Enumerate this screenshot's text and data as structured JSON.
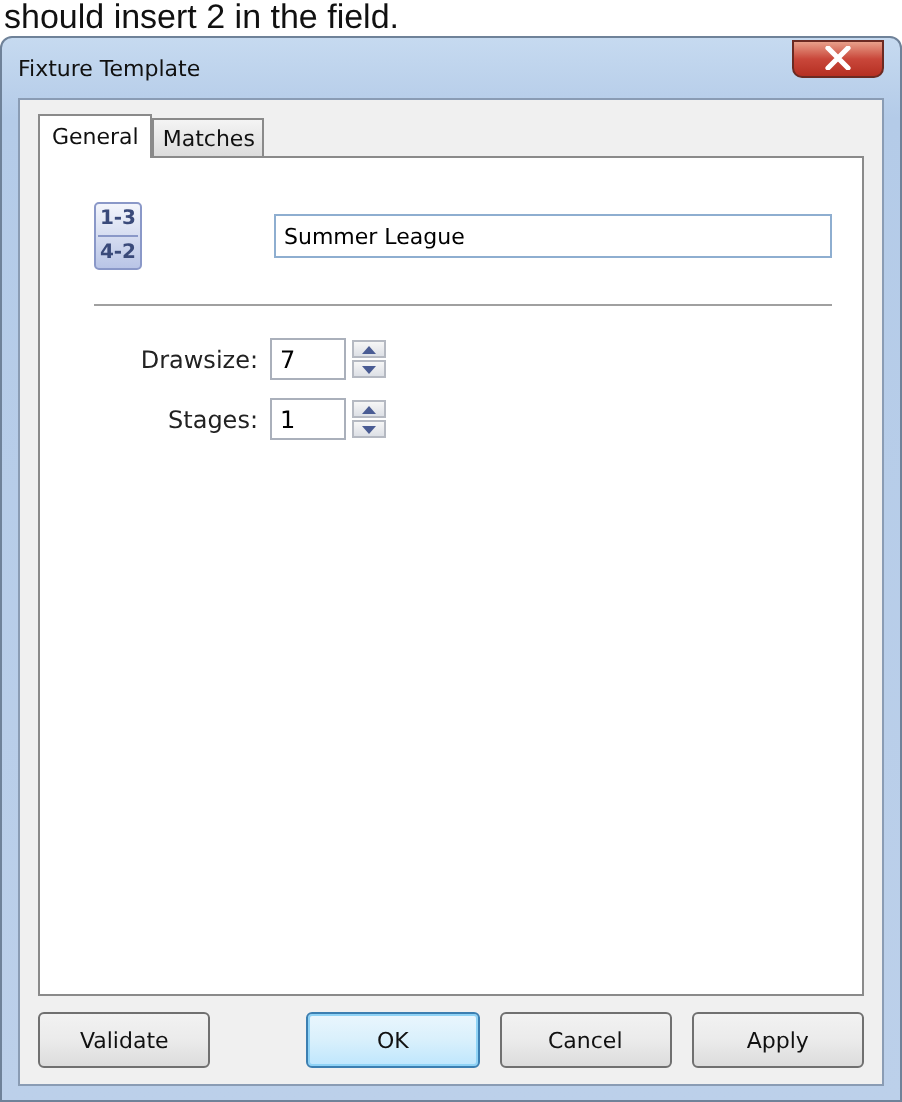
{
  "caption": "should insert 2 in the field.",
  "window": {
    "title": "Fixture Template"
  },
  "tabs": [
    {
      "label": "General",
      "selected": true
    },
    {
      "label": "Matches",
      "selected": false
    }
  ],
  "fixture_icon": {
    "lines": [
      "1-3",
      "4-2"
    ]
  },
  "name_field": {
    "value": "Summer League"
  },
  "spinners": [
    {
      "label": "Drawsize:",
      "value": "7"
    },
    {
      "label": "Stages:",
      "value": "1"
    }
  ],
  "buttons": [
    {
      "label": "Validate",
      "default": false
    },
    {
      "label": "OK",
      "default": true
    },
    {
      "label": "Cancel",
      "default": false
    },
    {
      "label": "Apply",
      "default": false
    }
  ]
}
